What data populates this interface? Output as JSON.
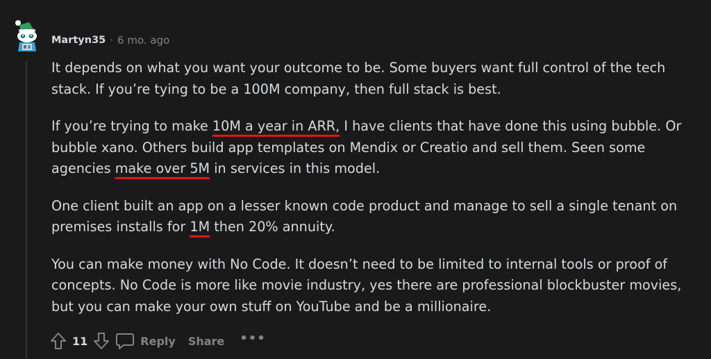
{
  "comment": {
    "author": "Martyn35",
    "separator": "·",
    "time": "6 mo. ago",
    "avatar_icon": "snoo-avatar-icon",
    "paragraphs": [
      {
        "lines": [
          [
            {
              "text": "It depends on what you want your outcome to be. Some buyers want full control of the tech"
            }
          ],
          [
            {
              "text": "stack. If you’re tying to be a 100M company, then full stack is best."
            }
          ]
        ]
      },
      {
        "lines": [
          [
            {
              "text": "If you’re trying to make "
            },
            {
              "text": "10M a year in ARR,",
              "underline": true
            },
            {
              "text": " I have clients that have done this using bubble. Or"
            }
          ],
          [
            {
              "text": "bubble xano. Others build app templates on Mendix or Creatio and sell them. Seen some"
            }
          ],
          [
            {
              "text": "agencies "
            },
            {
              "text": "make over 5M",
              "underline": true
            },
            {
              "text": " in services in this model."
            }
          ]
        ]
      },
      {
        "lines": [
          [
            {
              "text": "One client built an app on a lesser known code product and manage to sell a single tenant on"
            }
          ],
          [
            {
              "text": "premises installs for "
            },
            {
              "text": "1M",
              "underline": true
            },
            {
              "text": " then 20% annuity."
            }
          ]
        ]
      },
      {
        "lines": [
          [
            {
              "text": "You can make money with No Code. It doesn’t need to be limited to internal tools or proof of"
            }
          ],
          [
            {
              "text": "concepts. No Code is more like movie industry, yes there are professional blockbuster movies,"
            }
          ],
          [
            {
              "text": "but you can make your own stuff on YouTube and be a millionaire."
            }
          ]
        ]
      }
    ]
  },
  "actions": {
    "vote_count": "11",
    "reply_label": "Reply",
    "share_label": "Share",
    "more_label": "•••",
    "icons": {
      "upvote": "upvote-arrow-icon",
      "downvote": "downvote-arrow-icon",
      "reply": "speech-bubble-icon",
      "more": "ellipsis-icon"
    }
  },
  "colors": {
    "background": "#1a1a1b",
    "text": "#d7dadc",
    "meta": "#818384",
    "highlight_underline": "#e01818"
  }
}
